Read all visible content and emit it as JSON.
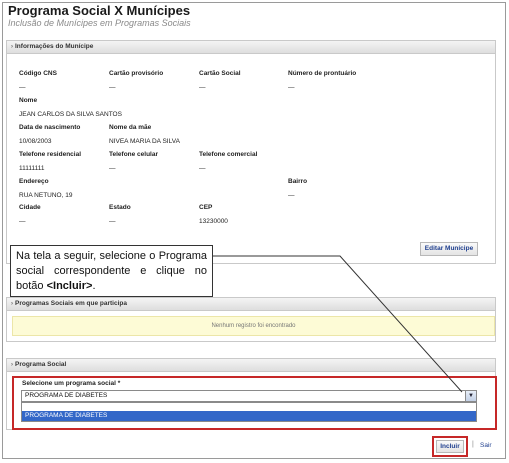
{
  "header": {
    "title": "Programa Social X Munícipes",
    "subtitle": "Inclusão de Munícipes em Programas Sociais"
  },
  "municipe_panel": {
    "title": "Informações do Munícipe",
    "fields": {
      "cns": {
        "label": "Código CNS",
        "value": "—"
      },
      "cartao_provisorio": {
        "label": "Cartão provisório",
        "value": "—"
      },
      "cartao_social": {
        "label": "Cartão Social",
        "value": "—"
      },
      "prontuario": {
        "label": "Número de prontuário",
        "value": "—"
      },
      "nome": {
        "label": "Nome",
        "value": "JEAN CARLOS DA SILVA SANTOS"
      },
      "nascimento": {
        "label": "Data de nascimento",
        "value": "10/08/2003"
      },
      "mae": {
        "label": "Nome da mãe",
        "value": "NIVEA MARIA DA SILVA"
      },
      "tel_residencial": {
        "label": "Telefone residencial",
        "value": "11111111"
      },
      "tel_celular": {
        "label": "Telefone celular",
        "value": "—"
      },
      "tel_comercial": {
        "label": "Telefone comercial",
        "value": "—"
      },
      "endereco": {
        "label": "Endereço",
        "value": "RUA NETUNO, 19"
      },
      "bairro": {
        "label": "Bairro",
        "value": "—"
      },
      "cidade": {
        "label": "Cidade",
        "value": "—"
      },
      "estado": {
        "label": "Estado",
        "value": "—"
      },
      "cep": {
        "label": "CEP",
        "value": "13230000"
      }
    },
    "edit_button": "Editar Munícipe"
  },
  "callout": {
    "text_before": "Na tela a seguir, selecione o Programa social correspondente e clique no botão ",
    "text_bold": "<Incluir>",
    "text_after": "."
  },
  "programas_panel": {
    "title": "Programas Sociais em que participa",
    "empty_message": "Nenhum registro foi encontrado"
  },
  "programa_social_panel": {
    "title": "Programa Social",
    "select_label": "Selecione um programa social *",
    "selected_value": "PROGRAMA DE DIABETES",
    "options": [
      "PROGRAMA DE DIABETES"
    ]
  },
  "actions": {
    "incluir": "Incluir",
    "separator": "|",
    "sair": "Sair"
  },
  "colors": {
    "highlight_border": "#c62828",
    "selected_option": "#3367c8",
    "empty_row_bg": "#fdfbd6"
  }
}
